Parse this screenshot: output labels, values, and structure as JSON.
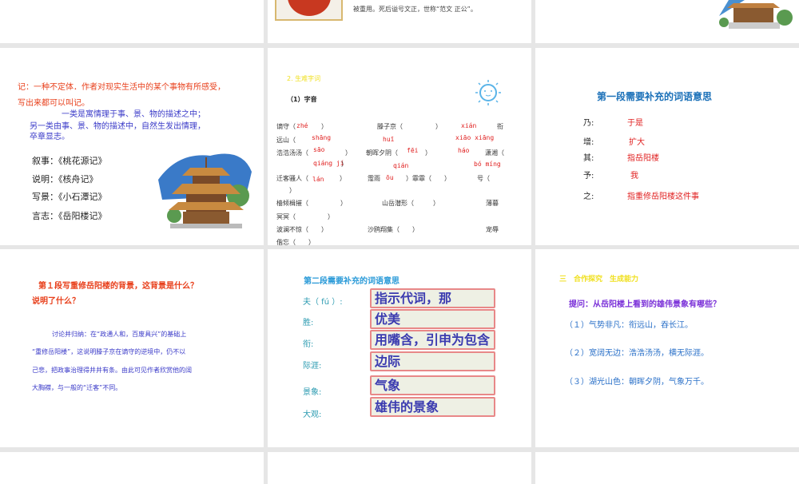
{
  "slides": {
    "top_mid": {
      "text": "被重用。死后谥号文正，世称“范文 正公”。"
    },
    "ji": {
      "red_lines": [
        "记：一种不定体．作者对现实生活中的某个事物有所感受，",
        "写出来都可以叫记。"
      ],
      "blue_lines": [
        "一类是寓情理于事、景、物的描述之中；",
        "另一类由事、景、物的描述中，自然生发出情理，",
        "卒章显志。"
      ],
      "list": [
        "叙事：《桃花源记》",
        "说明：《核舟记》",
        "写景：《小石潭记》",
        "言志：《岳阳楼记》"
      ]
    },
    "vocab": {
      "heading": "2. 生难字词",
      "subheading": "（1）字音",
      "items": [
        {
          "t": "谪守（",
          "p": "zhé",
          "e": "）"
        },
        {
          "t": "滕子京（",
          "e": "）"
        },
        {
          "p": "xián"
        },
        {
          "t": "衔"
        },
        {
          "t": "远山（"
        },
        {
          "p": "shāng"
        },
        {
          "p": "huī"
        },
        {
          "p": "xiāo xiāng"
        },
        {
          "t": "浩浩汤汤（",
          "e": "）"
        },
        {
          "p": "sāo"
        },
        {
          "t": "朝晖夕阴（"
        },
        {
          "p": "fēi"
        },
        {
          "e": "）"
        },
        {
          "p": "háo"
        },
        {
          "t": "潇湘（"
        },
        {
          "p": "qiáng jí"
        },
        {
          "e": "）"
        },
        {
          "p": "qián"
        },
        {
          "p": "bó míng"
        },
        {
          "t": "迁客骚人（"
        },
        {
          "p": "lán"
        },
        {
          "e": "）"
        },
        {
          "t": "霪雨"
        },
        {
          "p": "ōu"
        },
        {
          "t": "）霏霏（　　）"
        },
        {
          "t": "号（"
        },
        {
          "e": "）"
        },
        {
          "t": "樯倾楫摧（　　　　　）"
        },
        {
          "t": "山岳潜形（　　　）"
        },
        {
          "t": "薄暮"
        },
        {
          "t": "冥冥（　　　　　）"
        },
        {
          "t": "波澜不惊（　　）"
        },
        {
          "t": "沙鸥翔集（　　）"
        },
        {
          "t": "宠辱"
        },
        {
          "t": "偕忘（　　）"
        }
      ]
    },
    "para1": {
      "title": "第一段需要补充的词语意思",
      "rows": [
        {
          "k": "乃:",
          "v": "于是"
        },
        {
          "k": "增:",
          "v": "扩大"
        },
        {
          "k": "其:",
          "v": "指岳阳楼"
        },
        {
          "k": "予:",
          "v": "我"
        },
        {
          "k": "之:",
          "v": "指重修岳阳楼这件事"
        }
      ]
    },
    "bg": {
      "q1": "第１段写重修岳阳楼的背景，这背景是什么？",
      "q2": "说明了什么？",
      "body": [
        "讨论并归纳：在“政通人和，百废具兴”的基础上",
        "“重修岳阳楼”，这说明滕子京在谪守的逆境中，仍不以",
        "己悲，把政事治理得井井有条。由此可见作者欣赏他的阔",
        "大胸襟，与一般的“迁客”不同。"
      ]
    },
    "para2": {
      "title": "第二段需要补充的词语意思",
      "rows": [
        {
          "k": "夫（ fú ）:",
          "v": "指示代词，那"
        },
        {
          "k": "胜:",
          "v": "优美"
        },
        {
          "k": "衔:",
          "v": "用嘴含，引申为包含"
        },
        {
          "k": "际涯:",
          "v": "边际"
        },
        {
          "k": "景象:",
          "v": "气象"
        },
        {
          "k": "大观:",
          "v": "雄伟的景象"
        }
      ]
    },
    "explore": {
      "title": "三　合作探究　生成能力",
      "question": "提问：从岳阳楼上看到的雄伟景象有哪些？",
      "answers": [
        "（１）气势非凡：衔远山，吞长江。",
        "（２）宽阔无边：浩浩汤汤，横无际涯。",
        "（３）湖光山色：朝晖夕阴，气象万千。"
      ]
    }
  }
}
